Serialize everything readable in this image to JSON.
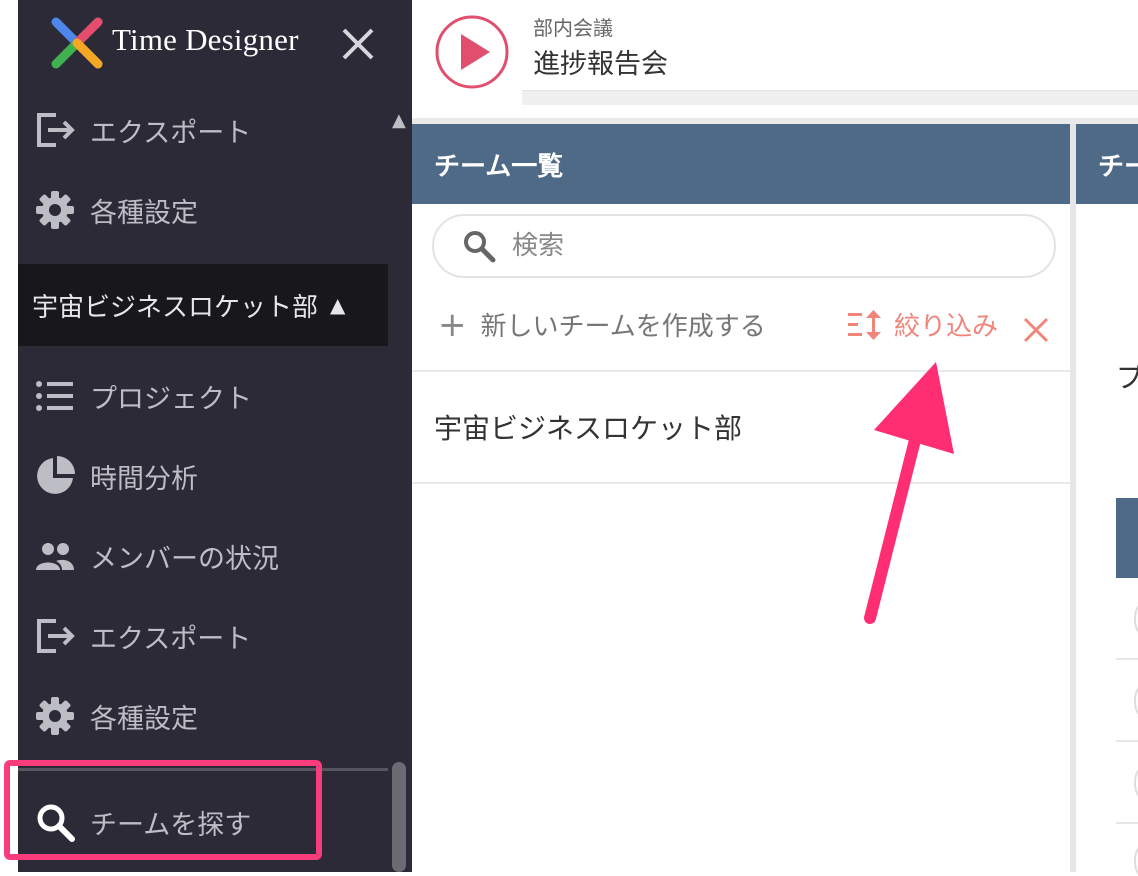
{
  "app": {
    "title": "Time Designer"
  },
  "sidebar": {
    "top_items": [
      {
        "label": "エクスポート",
        "icon": "export-icon"
      },
      {
        "label": "各種設定",
        "icon": "gear-icon"
      }
    ],
    "section": {
      "label": "宇宙ビジネスロケット部",
      "icon": "triangle-up-icon"
    },
    "items": [
      {
        "label": "プロジェクト",
        "icon": "list-icon"
      },
      {
        "label": "時間分析",
        "icon": "pie-chart-icon"
      },
      {
        "label": "メンバーの状況",
        "icon": "people-icon"
      },
      {
        "label": "エクスポート",
        "icon": "export-icon"
      },
      {
        "label": "各種設定",
        "icon": "gear-icon"
      }
    ],
    "find_team": {
      "label": "チームを探す",
      "icon": "search-icon"
    }
  },
  "header": {
    "subtitle": "部内会議",
    "title": "進捗報告会"
  },
  "team_panel": {
    "title": "チーム一覧",
    "search_placeholder": "検索",
    "create_label": "新しいチームを作成する",
    "filter_label": "絞り込み",
    "teams": [
      "宇宙ビジネスロケット部"
    ]
  },
  "right_panel": {
    "title_fragment": "チー",
    "text_fragment": "プ"
  },
  "colors": {
    "sidebar_bg": "#2b2a36",
    "panel_header": "#4e6a87",
    "highlight": "#fb3c7c",
    "filter": "#f0857a",
    "play": "#e0506e"
  }
}
